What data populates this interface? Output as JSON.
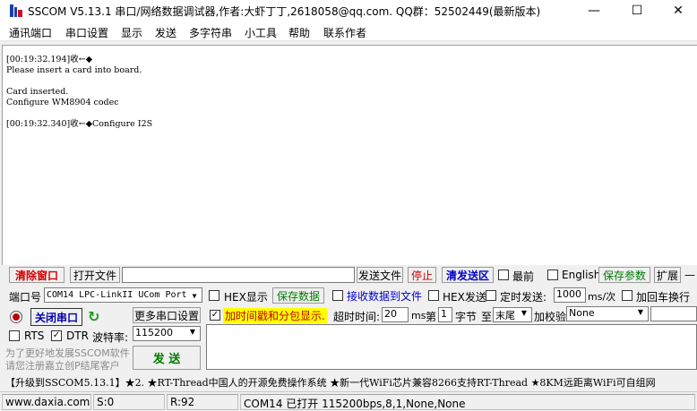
{
  "window": {
    "title": "SSCOM V5.13.1 串口/网络数据调试器,作者:大虾丁丁,2618058@qq.com. QQ群：52502449(最新版本)",
    "minimize_glyph": "—",
    "maximize_glyph": "☐",
    "close_glyph": "✕"
  },
  "menu": [
    "通讯端口",
    "串口设置",
    "显示",
    "发送",
    "多字符串",
    "小工具",
    "帮助",
    "联系作者"
  ],
  "receive": {
    "lines": [
      "[00:19:32.194]收←◆",
      "Please insert a card into board.",
      "",
      "Card inserted.",
      "Configure WM8904 codec",
      "",
      "[00:19:32.340]收←◆Configure I2S"
    ]
  },
  "toolbar": {
    "clear_window": "清除窗口",
    "open_file": "打开文件",
    "send_file": "发送文件",
    "stop": "停止",
    "clear_send": "清发送区",
    "topmost": "最前",
    "english": "English",
    "save_params": "保存参数",
    "expand": "扩展",
    "collapse": "—"
  },
  "port": {
    "label": "端口号",
    "value": "COM14 LPC-LinkII UCom Port",
    "close_port": "关闭串口",
    "more_settings": "更多串口设置",
    "rts": "RTS",
    "dtr": "DTR",
    "baud_label": "波特率:",
    "baud_value": "115200"
  },
  "options": {
    "hex_display": "HEX显示",
    "save_data": "保存数据",
    "recv_to_file": "接收数据到文件",
    "hex_send": "HEX发送",
    "timed_send": "定时发送:",
    "interval": "1000",
    "interval_unit": "ms/次",
    "add_crlf": "加回车换行",
    "timestamp": "加时间戳和分包显示.",
    "timeout_label": "超时时间:",
    "timeout_value": "20",
    "ms": "ms",
    "nth": "第",
    "byte_index": "1",
    "byte_unit": "字节",
    "to": "至",
    "end": "末尾",
    "checksum": "加校验",
    "checksum_value": "None"
  },
  "promo": {
    "line1": "为了更好地发展SSCOM软件",
    "line2": "请您注册嘉立创P结尾客户",
    "send": "发  送"
  },
  "banner": "【升级到SSCOM5.13.1】★2. ★RT-Thread中国人的开源免费操作系统 ★新一代WiFi芯片兼容8266支持RT-Thread ★8KM远距离WiFi可自组网",
  "status": {
    "site": "www.daxia.com",
    "sent": "S:0",
    "received": "R:92",
    "port_status": "COM14 已打开  115200bps,8,1,None,None"
  }
}
